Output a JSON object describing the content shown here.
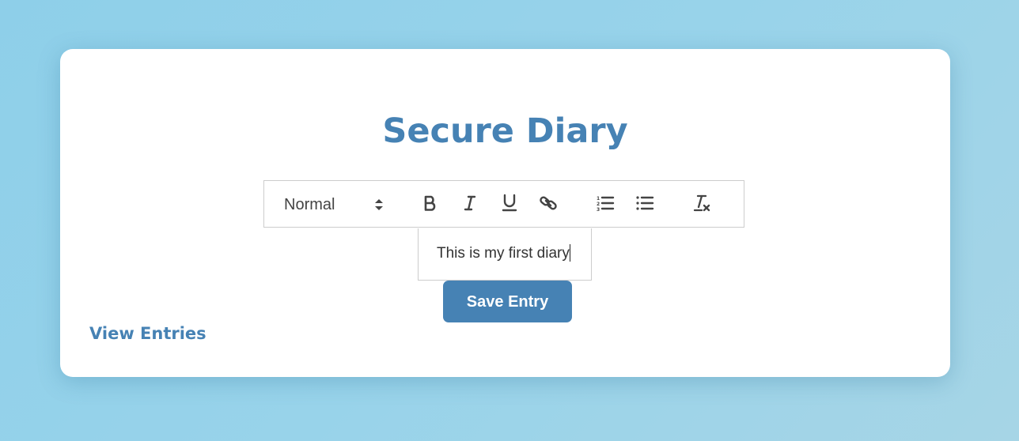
{
  "page": {
    "title": "Secure Diary"
  },
  "toolbar": {
    "header_picker": {
      "selected": "Normal",
      "icon": "up-down-arrows-icon"
    },
    "buttons": [
      {
        "name": "bold",
        "icon": "bold-icon"
      },
      {
        "name": "italic",
        "icon": "italic-icon"
      },
      {
        "name": "underline",
        "icon": "underline-icon"
      },
      {
        "name": "link",
        "icon": "link-icon"
      },
      {
        "name": "ordered-list",
        "icon": "ordered-list-icon"
      },
      {
        "name": "bullet-list",
        "icon": "bullet-list-icon"
      },
      {
        "name": "clear-formatting",
        "icon": "clear-format-icon"
      }
    ]
  },
  "editor": {
    "content": "This is my first diary"
  },
  "actions": {
    "save_label": "Save Entry",
    "view_entries_label": "View Entries"
  },
  "colors": {
    "accent": "#4682b4",
    "background": "#94d1ea",
    "card": "#ffffff",
    "icon": "#444444",
    "border": "#cccccc"
  }
}
